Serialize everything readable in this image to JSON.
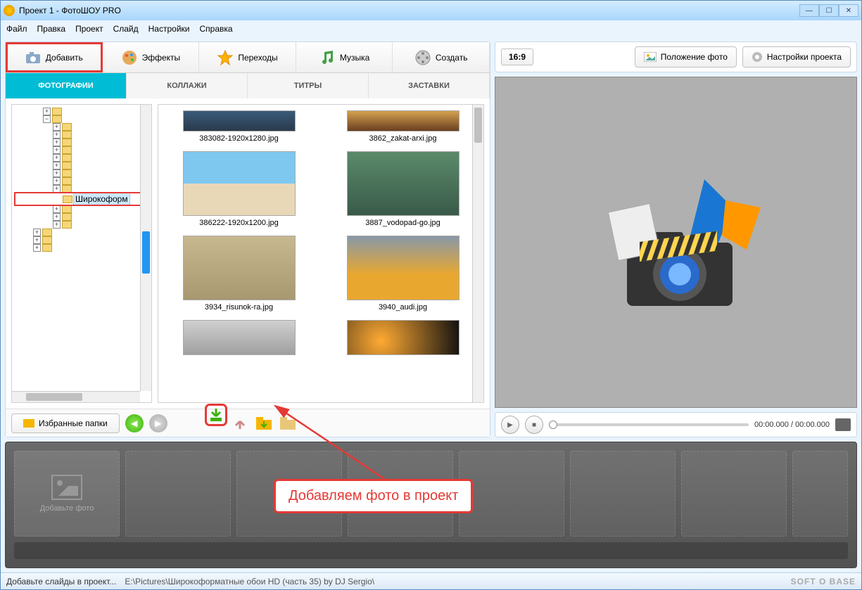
{
  "window": {
    "title": "Проект 1 - ФотоШОУ PRO"
  },
  "menu": {
    "file": "Файл",
    "edit": "Правка",
    "project": "Проект",
    "slide": "Слайд",
    "settings": "Настройки",
    "help": "Справка"
  },
  "toolbar": {
    "add": "Добавить",
    "effects": "Эффекты",
    "transitions": "Переходы",
    "music": "Музыка",
    "create": "Создать"
  },
  "tabs": {
    "photos": "ФОТОГРАФИИ",
    "collages": "КОЛЛАЖИ",
    "titles": "ТИТРЫ",
    "splash": "ЗАСТАВКИ"
  },
  "tree": {
    "selected": "Широкоформ"
  },
  "thumbs": [
    "383082-1920x1280.jpg",
    "3862_zakat-arxi.jpg",
    "386222-1920x1200.jpg",
    "3887_vodopad-go.jpg",
    "3934_risunok-ra.jpg",
    "3940_audi.jpg"
  ],
  "fav": {
    "label": "Избранные папки"
  },
  "right": {
    "aspect": "16:9",
    "pos": "Положение фото",
    "settings": "Настройки проекта"
  },
  "play": {
    "time": "00:00.000 / 00:00.000"
  },
  "timeline": {
    "placeholder": "Добавьте фото"
  },
  "status": {
    "hint": "Добавьте слайды в проект...",
    "path": "E:\\Pictures\\Широкоформатные обои HD (часть 35) by DJ Sergio\\",
    "brand": "SOFT O BASE"
  },
  "annotation": "Добавляем фото в проект"
}
